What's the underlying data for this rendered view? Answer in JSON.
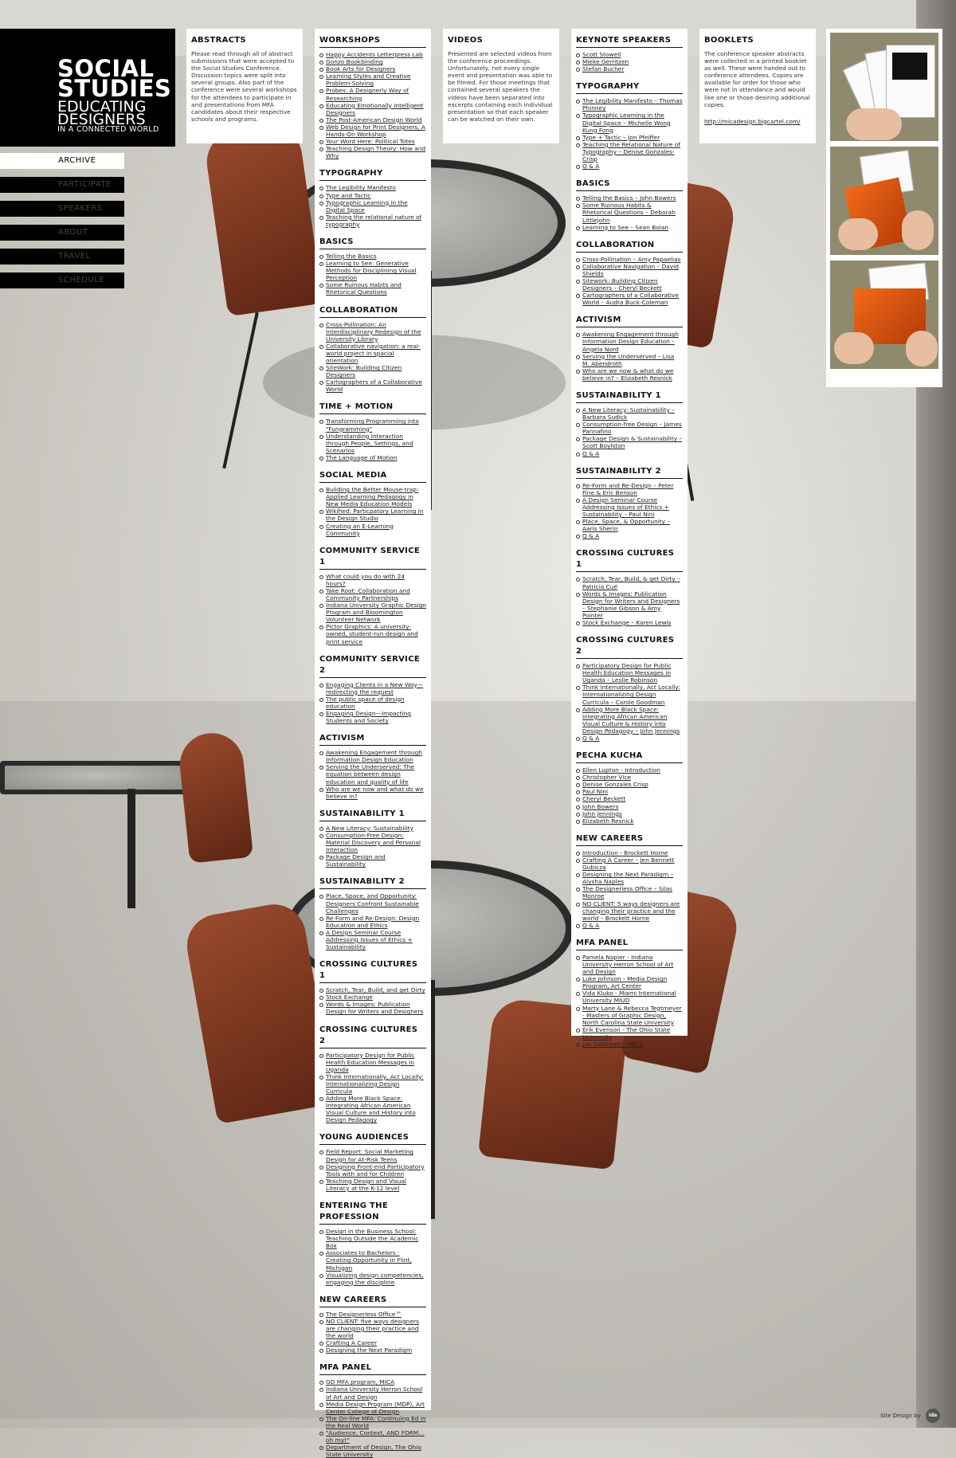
{
  "logo": {
    "line1": "SOCIAL",
    "line2": "STUDIES",
    "line3": "EDUCATING",
    "line4": "DESIGNERS",
    "line5": "IN A CONNECTED WORLD"
  },
  "nav": {
    "items": [
      {
        "label": "ARCHIVE",
        "active": true
      },
      {
        "label": "PARTICIPATE",
        "active": false
      },
      {
        "label": "SPEAKERS",
        "active": false
      },
      {
        "label": "ABOUT",
        "active": false
      },
      {
        "label": "TRAVEL",
        "active": false
      },
      {
        "label": "SCHEDULE",
        "active": false
      }
    ]
  },
  "abstracts": {
    "title": "ABSTRACTS",
    "text": "Please read through all of abstract submissions that were accepted to the Social Studies Conference. Discussion topics were split into several groups. Also part of the conference were several workshops for the attendees to participate in and presentations from MFA candidates about their respective schools and programs."
  },
  "videos": {
    "title": "VIDEOS",
    "text": "Presented are selected videos from the conference proceedings. Unfortunately, not every single event and presentation was able to be filmed. For those meetings that contained several speakers the videos have been separated into excerpts containing each individual presentation so that each speaker can be watched on their own."
  },
  "booklets": {
    "title": "BOOKLETS",
    "text": "The conference speaker abstracts were collected in a printed booklet as well. These were handed out to conference attendees. Copies are available for order for those who were not in attendance and would like one or those desiring additional copies.",
    "link": "http://micadesign.bigcartel.com/"
  },
  "abstract_sections": [
    {
      "title": "WORKSHOPS",
      "items": [
        "Happy Accidents Letterpress Lab",
        "Gonzo Bookbinding",
        "Book Arts for Designers",
        "Learning Styles and Creative Problem-Solving",
        "Probes: A Designerly Way of Researching",
        "Educating Emotionally Intelligent Designers",
        "The Post-American Design World",
        "Web Design for Print Designers, A Hands-On Workshop",
        "Your Word Here: Political Totes",
        "Teaching Design Theory: How and Why"
      ]
    },
    {
      "title": "TYPOGRAPHY",
      "items": [
        "The Legibility Manifesto",
        "Type and Tactic",
        "Typographic Learning in the Digital Space",
        "Teaching the relational nature of typography"
      ]
    },
    {
      "title": "BASICS",
      "items": [
        "Telling the Basics",
        "Learning to See: Generative Methods for Disciplining Visual Perception",
        "Some Ruinous Habits and Rhetorical Questions"
      ]
    },
    {
      "title": "COLLABORATION",
      "items": [
        "Cross-Pollination: An Interdisciplinary Redesign of the University Library",
        "Collaborative navigation: a real-world project in spacial orientation",
        "SiteWork: Building Citizen Designers",
        "Cartographers of a Collaborative World"
      ]
    },
    {
      "title": "TIME + MOTION",
      "items": [
        "Transforming Programming into \"Fungramming\"",
        "Understanding Interaction through People, Settings, and Scenarios",
        "The Language of Motion"
      ]
    },
    {
      "title": "SOCIAL MEDIA",
      "items": [
        "Building the Better Mouse-trap: Applied Learning Pedagogy in New Media Education Models",
        "Wikified: Particpatory Learning in the Design Studio",
        "Creating an E-Learning Community"
      ]
    },
    {
      "title": "COMMUNITY SERVICE 1",
      "items": [
        "What could you do with 24 hours?",
        "Take Root: Collaboration and Community Partnerships",
        "Indiana University Graphic Design Program and Bloomington Volunteer Network",
        "Pictor Graphics: A university-owned, student-run design and print service"
      ]
    },
    {
      "title": "COMMUNITY SERVICE 2",
      "items": [
        "Engaging Clients in a New Way—redirecting the request",
        "The public space of design education",
        "Engaging Design—Impacting Students and Society"
      ]
    },
    {
      "title": "ACTIVISM",
      "items": [
        "Awakening Engagement through Information Design Education",
        "Serving the Underserved: The equation between design education and quality of life",
        "Who are we now and what do we believe in?"
      ]
    },
    {
      "title": "SUSTAINABILITY 1",
      "items": [
        "A New Literacy: Sustainability",
        "Consumption-Free Design: Material Discovery and Personal Interaction",
        "Package Design and Sustainability"
      ]
    },
    {
      "title": "SUSTAINABILITY 2",
      "items": [
        "Place, Space, and Opportunity: Designers Confront Sustainable Challenges",
        "Re-Form and Re-Design: Design Education and Ethics",
        "A Design Seminar Course Addressing Issues of Ethics + Sustainability"
      ]
    },
    {
      "title": "CROSSING CULTURES 1",
      "items": [
        "Scratch, Tear, Build, and get Dirty",
        "Stock Exchange",
        "Words & Images: Publication Design for Writers and Designers"
      ]
    },
    {
      "title": "CROSSING CULTURES 2",
      "items": [
        "Participatory Design for Public Health Education Messages in Uganda",
        "Think Internationally, Act Locally: Internationalizing Design Curricula",
        "Adding More Black Space: Integrating African American Visual Culture and History into Design Pedagogy"
      ]
    },
    {
      "title": "YOUNG AUDIENCES",
      "items": [
        "Field Report: Social Marketing Design for At-Risk Teens",
        "Designing Front-end Participatory Tools with and for Children",
        "Teaching Design and Visual Literacy at the K-12 level"
      ]
    },
    {
      "title": "ENTERING THE PROFESSION",
      "items": [
        "Design in the Business School: Teaching Outside the Academic Box",
        "Associates to Bachelors : Creating Opportunity in Flint, Michigan",
        "Visualizing design competencies, engaging the discipline"
      ]
    },
    {
      "title": "NEW CAREERS",
      "items": [
        "The Designerless Office™",
        "NO CLIENT: five ways designers are changing their practice and the world",
        "Crafting A Career",
        "Designing the Next Paradigm"
      ]
    },
    {
      "title": "MFA PANEL",
      "items": [
        "GD MFA program, MICA",
        "Indiana University Herron School of Art and Design",
        "Media Design Program (MDP), Art Center College of Design",
        "The On-line MFA: Continuing Ed in the Real World",
        "\"Audience, Context, AND FORM… oh my!\"",
        "Department of Design, The Ohio State University"
      ]
    }
  ],
  "video_sections": [
    {
      "title": "KEYNOTE SPEAKERS",
      "items": [
        "Scott Stowell",
        "Mieke Gerritzen",
        "Stefan Bucher"
      ]
    },
    {
      "title": "TYPOGRAPHY",
      "items": [
        "The Legibility Manifesto – Thomas Phinney",
        "Typographic Learning in the Digital Space – Michelle Wong Kung Fong",
        "Type + Tactic – Jon Pfeiffer",
        "Teaching the Relational Nature of Typography – Denise Gonzales-Crisp",
        "Q & A"
      ]
    },
    {
      "title": "BASICS",
      "items": [
        "Telling the Basics – John Bowers",
        "Some Ruinous Habits & Rhetorical Questions – Deborah Littlejohn",
        "Learning to See – Sean Bolan"
      ]
    },
    {
      "title": "COLLABORATION",
      "items": [
        "Cross-Pollination – Amy Papaelias",
        "Collaborative Navigation – David Shields",
        "Sitework: Building Citizen Designers – Cheryl Beckett",
        "Cartographers of a Collaborative World – Audra Buck-Coleman"
      ]
    },
    {
      "title": "ACTIVISM",
      "items": [
        "Awakening Engagement through Information Design Education – Angela Nord",
        "Serving the Underserved – Lisa M. Abendroth",
        "Who are we now & what do we believe in? – Elizabeth Resnick"
      ]
    },
    {
      "title": "SUSTAINABILITY 1",
      "items": [
        "A New Literacy: Sustainability – Barbara Sudick",
        "Consumption-free Design – James Pannafino",
        "Package Design & Sustainability – Scott Boylston",
        "Q & A"
      ]
    },
    {
      "title": "SUSTAINABILITY 2",
      "items": [
        "Re-Form and Re-Design – Peter Fine & Eric Benson",
        "A Design Seminar Course Addressing Issues of Ethics + Sustainability – Paul Nini",
        "Place, Space, & Opportunity – Aaris Sherin",
        "Q & A"
      ]
    },
    {
      "title": "CROSSING CULTURES 1",
      "items": [
        "Scratch, Tear, Build, & get Dirty – Patricia Cué",
        "Words & Images: Publication Design for Writers and Designers – Stephanie Gibson & Amy Pointer",
        "Stock Exchange – Karen Lewis"
      ]
    },
    {
      "title": "CROSSING CULTURES 2",
      "items": [
        "Participatory Design for Public Health Education Messages in Uganda – Leslie Robinson",
        "Think Internationally, Act Locally: Internationalizing Design Curricula – Carole Goodman",
        "Adding More Black Space: Integrating African American Visual Culture & History into Design Pedagogy – John Jennings",
        "Q & A"
      ]
    },
    {
      "title": "PECHA KUCHA",
      "items": [
        "Ellen Lupton - Introduction",
        "Christopher Vice",
        "Denise Gonzales Crisp",
        "Paul Nini",
        "Cheryl Beckett",
        "John Bowers",
        "John Jennings",
        "Elizabeth Resnick"
      ]
    },
    {
      "title": "NEW CAREERS",
      "items": [
        "Introduction - Brockett Horne",
        "Crafting A Career – Jen Bennett Gubicza",
        "Designing the Next Paradigm – Alysha Naples",
        "The Designerless Office – Silas Monroe",
        "NO CLIENT: 5 ways designers are changing their practice and the world – Brockett Horne",
        "Q & A"
      ]
    },
    {
      "title": "MFA PANEL",
      "items": [
        "Pamela Napier - Indiana University Herron School of Art and Design",
        "Luke Johnson - Media Design Program, Art Center",
        "Vida Kluko - Miami International University MIUD",
        "Marty Lane & Rebecca Tegtmeyer - Masters of Graphic Design, North Carolina State University",
        "Erik Evenson - The Ohio State University",
        "Joe Galbreath - MICA"
      ]
    }
  ],
  "credit": {
    "text": "Site Design by",
    "mark": "ida"
  }
}
